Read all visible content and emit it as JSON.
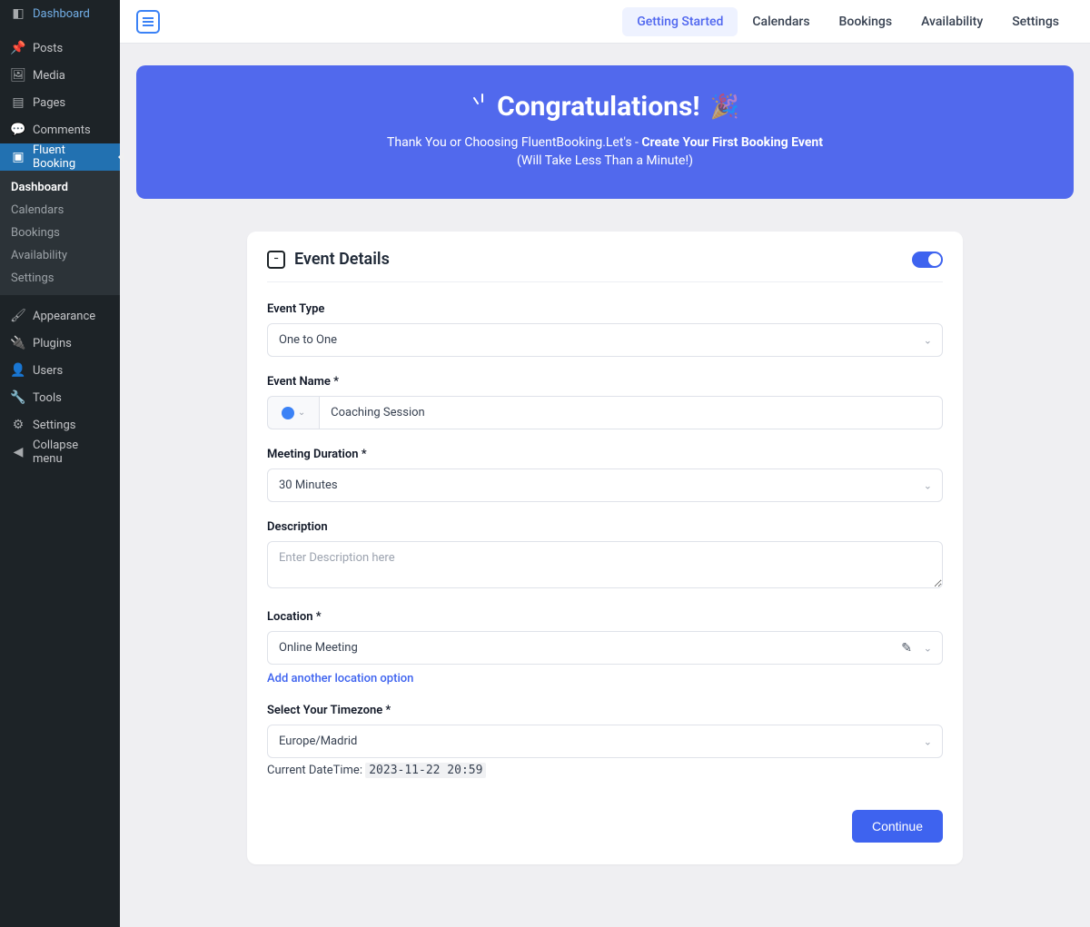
{
  "wp": {
    "top": [
      {
        "label": "Dashboard",
        "icon": "◧"
      },
      {
        "label": "Posts",
        "icon": "📌"
      },
      {
        "label": "Media",
        "icon": "🖼"
      },
      {
        "label": "Pages",
        "icon": "▤"
      },
      {
        "label": "Comments",
        "icon": "💬"
      }
    ],
    "active": {
      "label": "Fluent Booking",
      "icon": "▣"
    },
    "sub": [
      "Dashboard",
      "Calendars",
      "Bookings",
      "Availability",
      "Settings"
    ],
    "bottom": [
      {
        "label": "Appearance",
        "icon": "🖌"
      },
      {
        "label": "Plugins",
        "icon": "🔌"
      },
      {
        "label": "Users",
        "icon": "👤"
      },
      {
        "label": "Tools",
        "icon": "🔧"
      },
      {
        "label": "Settings",
        "icon": "⚙"
      },
      {
        "label": "Collapse menu",
        "icon": "◀"
      }
    ]
  },
  "topnav": [
    "Getting Started",
    "Calendars",
    "Bookings",
    "Availability",
    "Settings"
  ],
  "hero": {
    "title": "Congratulations!",
    "line1_a": "Thank You or Choosing FluentBooking.Let's - ",
    "line1_b": "Create Your First Booking Event",
    "line2": "(Will Take Less Than a Minute!)"
  },
  "card": {
    "title": "Event Details",
    "labels": {
      "event_type": "Event Type",
      "event_name": "Event Name *",
      "duration": "Meeting Duration *",
      "description": "Description",
      "location": "Location *",
      "timezone": "Select Your Timezone *"
    },
    "values": {
      "event_type": "One to One",
      "event_name": "Coaching Session",
      "duration": "30 Minutes",
      "description": "",
      "description_ph": "Enter Description here",
      "location": "Online Meeting",
      "timezone": "Europe/Madrid"
    },
    "add_location": "Add another location option",
    "dt_label": "Current DateTime:",
    "dt_value": "2023-11-22 20:59",
    "continue": "Continue"
  }
}
